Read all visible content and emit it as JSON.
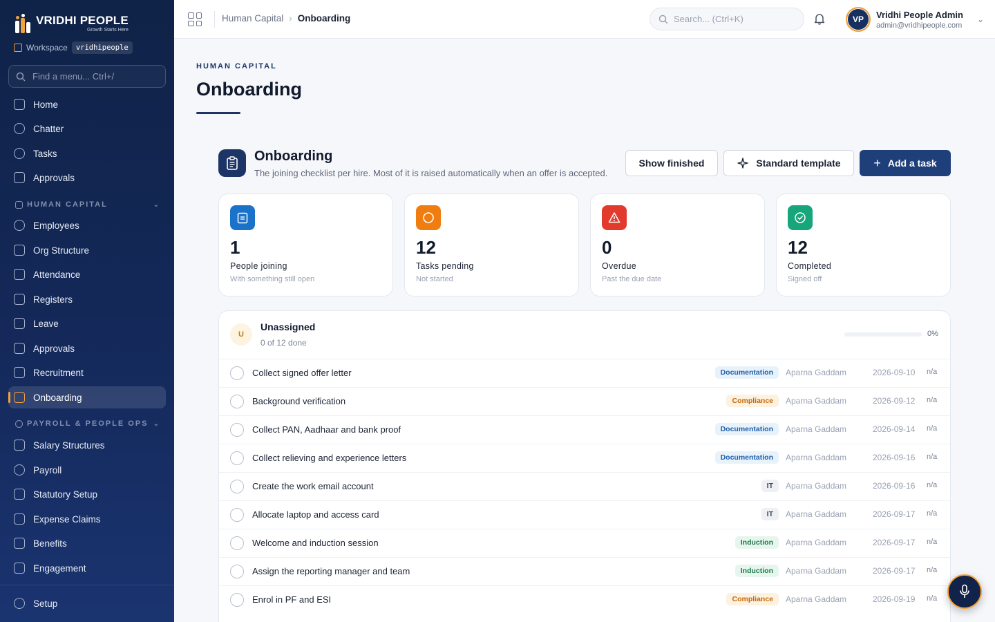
{
  "brand": {
    "name": "VRIDHI PEOPLE",
    "tagline": "Growth Starts Here"
  },
  "workspace": {
    "label": "Workspace",
    "value": "vridhipeople"
  },
  "sidebar": {
    "search_placeholder": "Find a menu... Ctrl+/",
    "top_items": [
      {
        "label": "Home",
        "icon": "home-icon"
      },
      {
        "label": "Chatter",
        "icon": "chat-icon"
      },
      {
        "label": "Tasks",
        "icon": "check-circle-icon"
      },
      {
        "label": "Approvals",
        "icon": "clipboard-icon"
      }
    ],
    "section_hc": "HUMAN CAPITAL",
    "hc_items": [
      {
        "label": "Employees",
        "icon": "users-icon"
      },
      {
        "label": "Org Structure",
        "icon": "org-chart-icon"
      },
      {
        "label": "Attendance",
        "icon": "calendar-icon"
      },
      {
        "label": "Registers",
        "icon": "clipboard-icon"
      },
      {
        "label": "Leave",
        "icon": "palm-tree-icon"
      },
      {
        "label": "Approvals",
        "icon": "clipboard-check-icon"
      },
      {
        "label": "Recruitment",
        "icon": "user-plus-icon"
      },
      {
        "label": "Onboarding",
        "icon": "building-icon",
        "active": true
      }
    ],
    "section_payroll": "PAYROLL & PEOPLE OPS",
    "payroll_items": [
      {
        "label": "Salary Structures",
        "icon": "layers-icon"
      },
      {
        "label": "Payroll",
        "icon": "rupee-icon"
      },
      {
        "label": "Statutory Setup",
        "icon": "bank-icon"
      },
      {
        "label": "Expense Claims",
        "icon": "receipt-icon"
      },
      {
        "label": "Benefits",
        "icon": "heart-icon"
      },
      {
        "label": "Engagement",
        "icon": "sparkle-icon"
      }
    ],
    "footer_item": {
      "label": "Setup",
      "icon": "gear-icon"
    }
  },
  "topbar": {
    "breadcrumb": [
      "Human Capital",
      "Onboarding"
    ],
    "search_placeholder": "Search... (Ctrl+K)",
    "user": {
      "initials": "VP",
      "name": "Vridhi People Admin",
      "email": "admin@vridhipeople.com"
    }
  },
  "page": {
    "eyebrow": "HUMAN CAPITAL",
    "title": "Onboarding"
  },
  "section": {
    "title": "Onboarding",
    "subtitle": "The joining checklist per hire. Most of it is raised automatically when an offer is accepted.",
    "buttons": {
      "show_finished": "Show finished",
      "standard_template": "Standard template",
      "add_task": "Add a task"
    }
  },
  "kpis": [
    {
      "value": "1",
      "label": "People joining",
      "sub": "With something still open",
      "color": "#1a73c8",
      "icon": "clipboard-icon"
    },
    {
      "value": "12",
      "label": "Tasks pending",
      "sub": "Not started",
      "color": "#f07d10",
      "icon": "circle-icon"
    },
    {
      "value": "0",
      "label": "Overdue",
      "sub": "Past the due date",
      "color": "#e23b2e",
      "icon": "warning-icon"
    },
    {
      "value": "12",
      "label": "Completed",
      "sub": "Signed off",
      "color": "#16a67a",
      "icon": "check-circle-icon"
    }
  ],
  "group": {
    "initial": "U",
    "name": "Unassigned",
    "progress_text": "0 of 12 done",
    "progress_fraction": 0,
    "percent_text": "0%"
  },
  "tasks": [
    {
      "name": "Collect signed offer letter",
      "tag": "Documentation",
      "tag_type": "doc",
      "owner": "Aparna Gaddam",
      "due": "2026-09-10",
      "extra": "n/a"
    },
    {
      "name": "Background verification",
      "tag": "Compliance",
      "tag_type": "comp",
      "owner": "Aparna Gaddam",
      "due": "2026-09-12",
      "extra": "n/a"
    },
    {
      "name": "Collect PAN, Aadhaar and bank proof",
      "tag": "Documentation",
      "tag_type": "doc",
      "owner": "Aparna Gaddam",
      "due": "2026-09-14",
      "extra": "n/a"
    },
    {
      "name": "Collect relieving and experience letters",
      "tag": "Documentation",
      "tag_type": "doc",
      "owner": "Aparna Gaddam",
      "due": "2026-09-16",
      "extra": "n/a"
    },
    {
      "name": "Create the work email account",
      "tag": "IT",
      "tag_type": "it",
      "owner": "Aparna Gaddam",
      "due": "2026-09-16",
      "extra": "n/a"
    },
    {
      "name": "Allocate laptop and access card",
      "tag": "IT",
      "tag_type": "it",
      "owner": "Aparna Gaddam",
      "due": "2026-09-17",
      "extra": "n/a"
    },
    {
      "name": "Welcome and induction session",
      "tag": "Induction",
      "tag_type": "ind",
      "owner": "Aparna Gaddam",
      "due": "2026-09-17",
      "extra": "n/a"
    },
    {
      "name": "Assign the reporting manager and team",
      "tag": "Induction",
      "tag_type": "ind",
      "owner": "Aparna Gaddam",
      "due": "2026-09-17",
      "extra": "n/a"
    },
    {
      "name": "Enrol in PF and ESI",
      "tag": "Compliance",
      "tag_type": "comp",
      "owner": "Aparna Gaddam",
      "due": "2026-09-19",
      "extra": "n/a"
    }
  ]
}
